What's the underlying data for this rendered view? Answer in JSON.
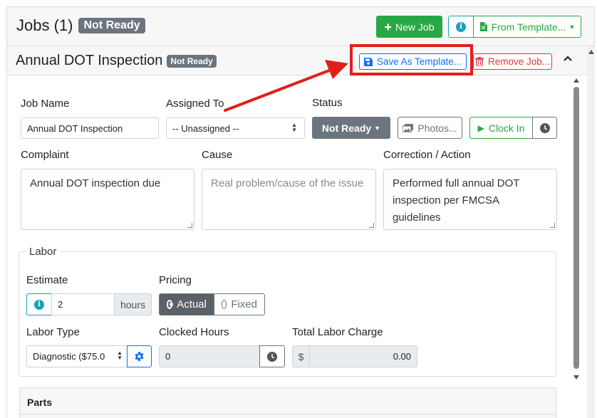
{
  "header": {
    "title": "Jobs (1)",
    "status_badge": "Not Ready",
    "new_job_label": "New Job",
    "info_glyph": "i",
    "from_template_label": "From Template..."
  },
  "job": {
    "title": "Annual DOT Inspection",
    "status_badge": "Not Ready",
    "save_template_label": "Save As Template...",
    "remove_job_label": "Remove Job..."
  },
  "form": {
    "job_name_label": "Job Name",
    "job_name_value": "Annual DOT Inspection",
    "assigned_to_label": "Assigned To",
    "assigned_to_value": "-- Unassigned --",
    "status_label": "Status",
    "status_value": "Not Ready",
    "photos_label": "Photos...",
    "clock_in_label": "Clock In",
    "complaint_label": "Complaint",
    "complaint_value": "Annual DOT inspection due",
    "cause_label": "Cause",
    "cause_placeholder": "Real problem/cause of the issue",
    "correction_label": "Correction / Action",
    "correction_value": "Performed full annual DOT inspection per FMCSA guidelines"
  },
  "labor": {
    "legend": "Labor",
    "estimate_label": "Estimate",
    "estimate_value": "2",
    "estimate_unit": "hours",
    "pricing_label": "Pricing",
    "pricing_options": [
      "Actual",
      "Fixed"
    ],
    "pricing_selected": "Actual",
    "labor_type_label": "Labor Type",
    "labor_type_value": "Diagnostic ($75.0",
    "clocked_hours_label": "Clocked Hours",
    "clocked_hours_value": "0",
    "total_charge_label": "Total Labor Charge",
    "currency_symbol": "$",
    "total_charge_value": "0.00"
  },
  "parts": {
    "title": "Parts"
  },
  "colors": {
    "success": "#28a745",
    "info": "#17a2b8",
    "primary": "#0d6efd",
    "danger": "#dc3545",
    "secondary": "#6c757d",
    "annotation": "#e0201b"
  }
}
